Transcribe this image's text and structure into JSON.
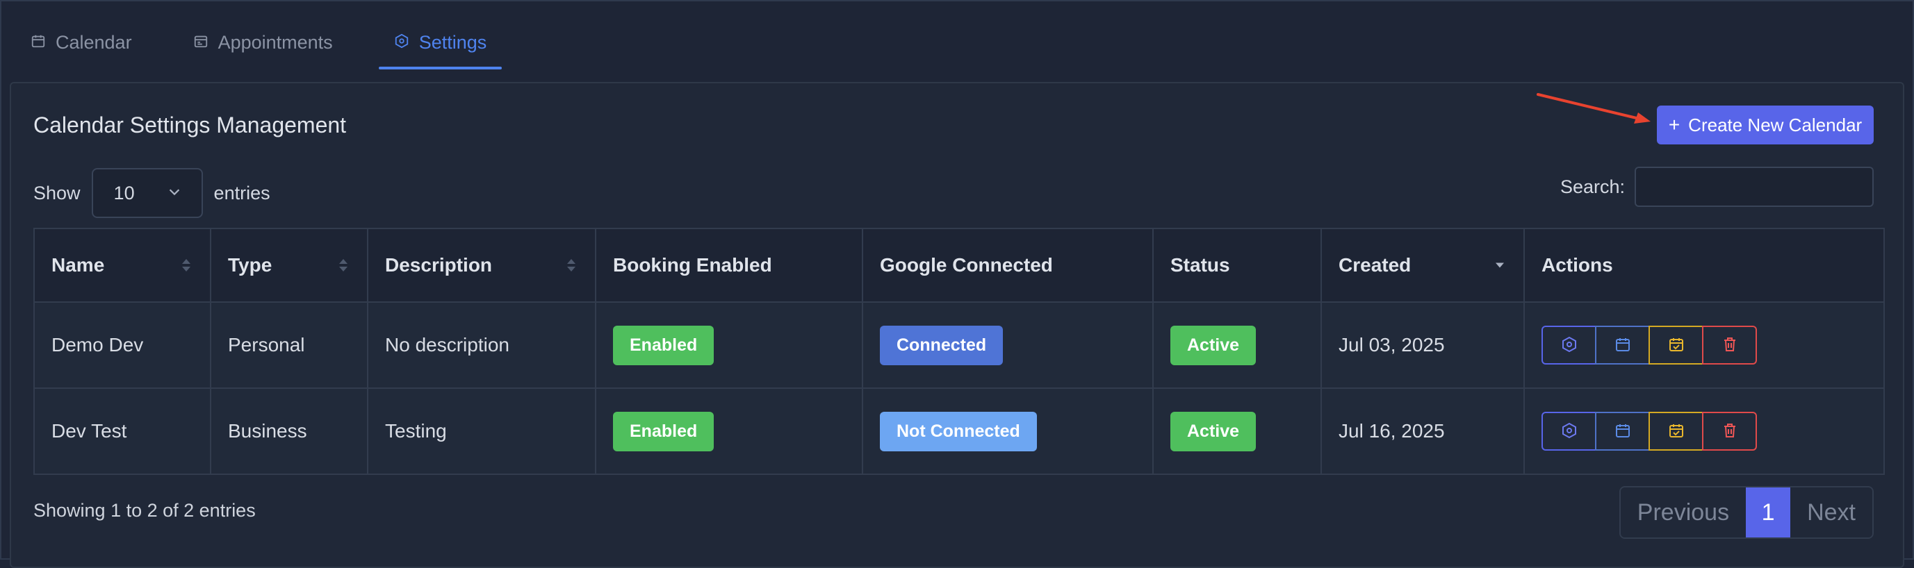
{
  "tabs": [
    {
      "label": "Calendar",
      "icon": "calendar-icon"
    },
    {
      "label": "Appointments",
      "icon": "appointments-icon"
    },
    {
      "label": "Settings",
      "icon": "settings-icon",
      "active": true
    }
  ],
  "card": {
    "title": "Calendar Settings Management",
    "create_button": "Create New Calendar"
  },
  "length": {
    "prefix": "Show",
    "value": "10",
    "suffix": "entries"
  },
  "search": {
    "label": "Search:",
    "value": "",
    "placeholder": ""
  },
  "table": {
    "columns": [
      "Name",
      "Type",
      "Description",
      "Booking Enabled",
      "Google Connected",
      "Status",
      "Created",
      "Actions"
    ],
    "rows": [
      {
        "name": "Demo Dev",
        "type": "Personal",
        "description": "No description",
        "booking": "Enabled",
        "google": "Connected",
        "status": "Active",
        "created": "Jul 03, 2025"
      },
      {
        "name": "Dev Test",
        "type": "Business",
        "description": "Testing",
        "booking": "Enabled",
        "google": "Not Connected",
        "status": "Active",
        "created": "Jul 16, 2025"
      }
    ]
  },
  "footer": {
    "info": "Showing 1 to 2 of 2 entries",
    "previous": "Previous",
    "page": "1",
    "next": "Next"
  },
  "colors": {
    "accent": "#5865e9",
    "tab_active": "#4f83ee",
    "success": "#4fbf5d",
    "connected": "#4f74d6",
    "not_connected": "#6da6f2",
    "warning": "#d4a923",
    "danger": "#e04a4a",
    "annotation_arrow": "#e8432f"
  }
}
